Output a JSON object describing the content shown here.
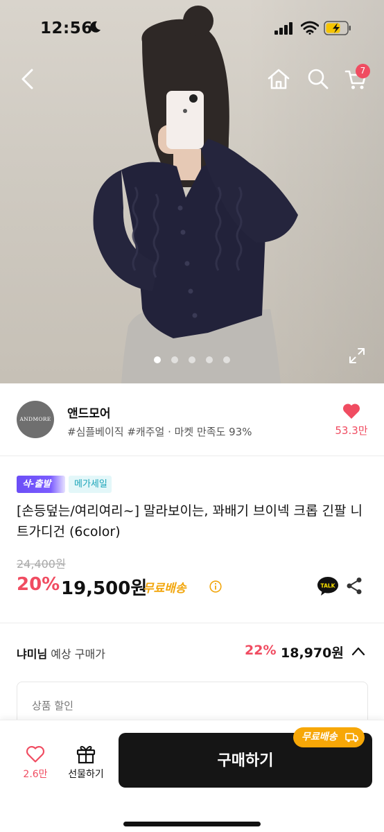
{
  "status_bar": {
    "time": "12:56"
  },
  "colors": {
    "accent": "#f04c61",
    "free_shipping": "#f7a707",
    "mega_sale": "#19a4b8",
    "fast_badge": "#6b4ef6"
  },
  "nav": {
    "cart_count": "7",
    "icons": [
      "back-icon",
      "home-icon",
      "search-icon",
      "cart-icon"
    ]
  },
  "gallery": {
    "image_count": 5,
    "current_index": 1
  },
  "seller": {
    "logo_text": "ANDMORE",
    "name": "앤드모어",
    "tags": "#심플베이직 #캐주얼 · 마켓 만족도 93%",
    "likes": "53.3만"
  },
  "product": {
    "badges": {
      "fast": "삭-출발",
      "mega": "메가세일"
    },
    "title": "[손등덮는/여리여리~] 말라보이는, 꽈배기 브이넥 크롭 긴팔 니트가디건 (6color)",
    "original_price": "24,400원",
    "discount": "20%",
    "price": "19,500원",
    "free_shipping": "무료배송",
    "talk_label": "TALK"
  },
  "expected_price": {
    "user": "냐미님",
    "label": "예상 구매가",
    "discount": "22%",
    "price": "18,970원"
  },
  "discount_box": {
    "label": "상품 할인"
  },
  "bottom_bar": {
    "like_count": "2.6만",
    "gift_label": "선물하기",
    "buy_label": "구매하기",
    "shipping_pill": "무료배송"
  }
}
